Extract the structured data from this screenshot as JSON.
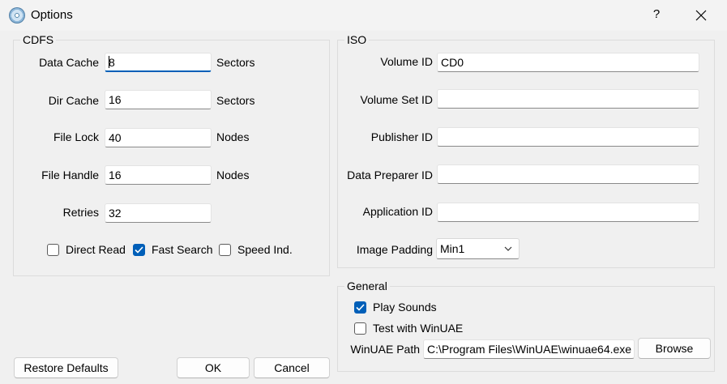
{
  "window": {
    "title": "Options",
    "help_label": "?",
    "close_label": "✕",
    "icon": "cd-disc-icon"
  },
  "cdfs": {
    "title": "CDFS",
    "data_cache": {
      "label": "Data Cache",
      "value": "8",
      "unit": "Sectors"
    },
    "dir_cache": {
      "label": "Dir Cache",
      "value": "16",
      "unit": "Sectors"
    },
    "file_lock": {
      "label": "File Lock",
      "value": "40",
      "unit": "Nodes"
    },
    "file_handle": {
      "label": "File Handle",
      "value": "16",
      "unit": "Nodes"
    },
    "retries": {
      "label": "Retries",
      "value": "32"
    },
    "direct_read": {
      "label": "Direct Read",
      "checked": false
    },
    "fast_search": {
      "label": "Fast Search",
      "checked": true
    },
    "speed_ind": {
      "label": "Speed Ind.",
      "checked": false
    }
  },
  "iso": {
    "title": "ISO",
    "volume_id": {
      "label": "Volume ID",
      "value": "CD0"
    },
    "volume_set_id": {
      "label": "Volume Set ID",
      "value": ""
    },
    "publisher_id": {
      "label": "Publisher ID",
      "value": ""
    },
    "data_preparer_id": {
      "label": "Data Preparer ID",
      "value": ""
    },
    "application_id": {
      "label": "Application ID",
      "value": ""
    },
    "image_padding": {
      "label": "Image Padding",
      "selected": "Min1"
    }
  },
  "general": {
    "title": "General",
    "play_sounds": {
      "label": "Play Sounds",
      "checked": true
    },
    "test_winuae": {
      "label": "Test with WinUAE",
      "checked": false
    },
    "winuae_path": {
      "label": "WinUAE Path",
      "value": "C:\\Program Files\\WinUAE\\winuae64.exe"
    },
    "browse_label": "Browse"
  },
  "buttons": {
    "restore_defaults": "Restore Defaults",
    "ok": "OK",
    "cancel": "Cancel"
  },
  "colors": {
    "accent": "#005fb8",
    "background": "#f0f0f0",
    "titlebar": "#f3f3f3"
  }
}
